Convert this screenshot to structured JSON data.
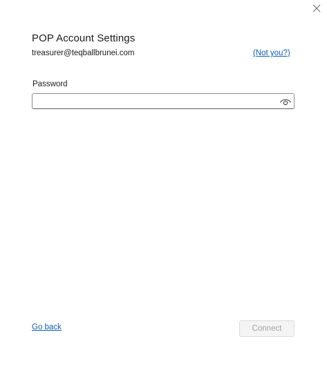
{
  "dialog": {
    "title": "POP Account Settings",
    "email": "treasurer@teqballbrunei.com",
    "not_you_link": "(Not you?)"
  },
  "password": {
    "label": "Password",
    "value": "",
    "placeholder": "",
    "reveal_icon": "eye-icon"
  },
  "footer": {
    "go_back_link": "Go back",
    "connect_label": "Connect",
    "connect_enabled": false
  },
  "icons": {
    "close": "close-icon"
  },
  "colors": {
    "link": "#0f5fb5",
    "disabled_text": "#a3a3a3",
    "disabled_bg": "#f4f4f4",
    "background": "#ffffff"
  }
}
